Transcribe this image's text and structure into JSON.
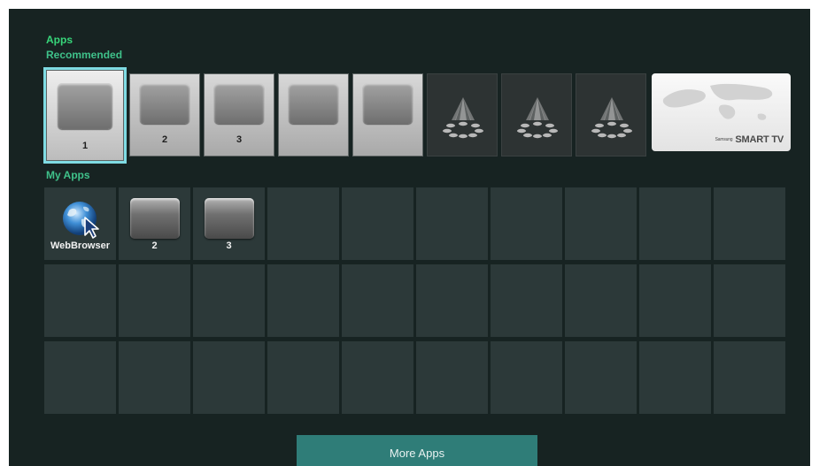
{
  "headings": {
    "apps": "Apps",
    "recommended": "Recommended",
    "my_apps": "My Apps"
  },
  "recommended": [
    {
      "label": "1",
      "kind": "app",
      "selected": true
    },
    {
      "label": "2",
      "kind": "app"
    },
    {
      "label": "3",
      "kind": "app"
    },
    {
      "label": "",
      "kind": "app"
    },
    {
      "label": "",
      "kind": "app"
    },
    {
      "label": "",
      "kind": "placeholder",
      "icon": "spotlight-icon"
    },
    {
      "label": "",
      "kind": "placeholder",
      "icon": "spotlight-icon"
    },
    {
      "label": "",
      "kind": "placeholder",
      "icon": "spotlight-icon"
    },
    {
      "label": "",
      "kind": "smart-tv",
      "brand_small": "Samsung",
      "brand": "SMART TV"
    }
  ],
  "my_apps": [
    {
      "label": "WebBrowser",
      "icon": "globe-cursor-icon"
    },
    {
      "label": "2",
      "icon": "app-icon"
    },
    {
      "label": "3",
      "icon": "app-icon"
    }
  ],
  "grid": {
    "columns": 10,
    "rows": 3
  },
  "more_apps_label": "More Apps",
  "colors": {
    "background": "#172322",
    "heading_apps": "#37d67a",
    "heading_sections": "#3fc18a",
    "selection": "#7fdbe3",
    "button": "#2f7d78"
  }
}
